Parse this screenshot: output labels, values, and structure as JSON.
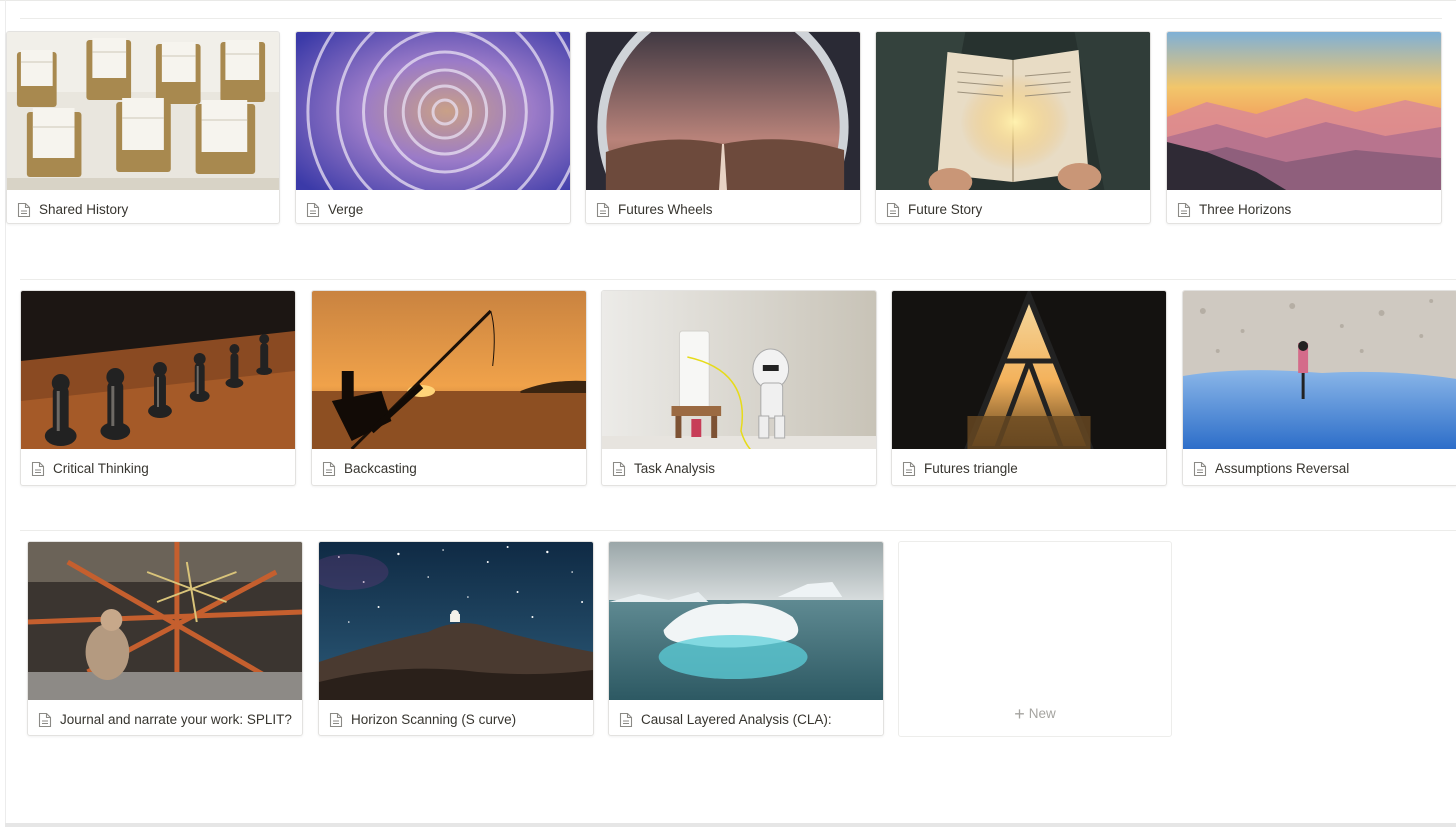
{
  "gallery": {
    "rows": [
      {
        "cards": [
          {
            "title": "Shared History",
            "cover": "rolodex-photo"
          },
          {
            "title": "Verge",
            "cover": "spiral-lattice-photo"
          },
          {
            "title": "Futures Wheels",
            "cover": "portal-desert-photo"
          },
          {
            "title": "Future Story",
            "cover": "glowing-book-photo"
          },
          {
            "title": "Three Horizons",
            "cover": "mountain-sunset-photo"
          }
        ]
      },
      {
        "cards": [
          {
            "title": "Critical Thinking",
            "cover": "chess-pieces-photo"
          },
          {
            "title": "Backcasting",
            "cover": "fishing-rod-sunset-photo"
          },
          {
            "title": "Task Analysis",
            "cover": "lego-stormtrooper-photo"
          },
          {
            "title": "Futures triangle",
            "cover": "triangle-window-photo"
          },
          {
            "title": "Assumptions Reversal",
            "cover": "reflection-lake-photo"
          }
        ]
      },
      {
        "cards": [
          {
            "title": "Journal and narrate your work: SPLIT?",
            "cover": "telescope-structure-photo"
          },
          {
            "title": "Horizon Scanning (S curve)",
            "cover": "observatory-night-photo"
          },
          {
            "title": "Causal Layered Analysis (CLA):",
            "cover": "iceberg-photo"
          }
        ]
      }
    ],
    "new_label": "New",
    "new_icon": "plus-icon",
    "card_icon": "page-icon"
  }
}
